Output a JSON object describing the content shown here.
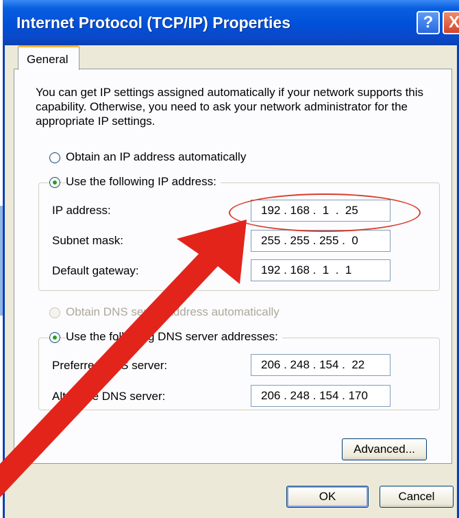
{
  "window": {
    "title": "Internet Protocol (TCP/IP) Properties",
    "help_label": "?",
    "close_label": "X"
  },
  "tab": {
    "label": "General"
  },
  "description": "You can get IP settings assigned automatically if your network supports this capability. Otherwise, you need to ask your network administrator for the appropriate IP settings.",
  "ip_section": {
    "auto_label": "Obtain an IP address automatically",
    "manual_label": "Use the following IP address:",
    "ip_label": "IP address:",
    "ip_value": "192 . 168 .  1  .  25",
    "subnet_label": "Subnet mask:",
    "subnet_value": "255 . 255 . 255 .  0",
    "gateway_label": "Default gateway:",
    "gateway_value": "192 . 168 .  1  .  1",
    "selected": "manual"
  },
  "dns_section": {
    "auto_label": "Obtain DNS server address automatically",
    "manual_label": "Use the following DNS server addresses:",
    "preferred_label": "Preferred DNS server:",
    "preferred_value": "206 . 248 . 154 .  22",
    "alternate_label": "Alternate DNS server:",
    "alternate_value": "206 . 248 . 154 . 170",
    "selected": "manual"
  },
  "buttons": {
    "advanced": "Advanced...",
    "ok": "OK",
    "cancel": "Cancel"
  },
  "colors": {
    "titlebar": "#0050d8",
    "annotation_red": "#e3241b",
    "deco_blue": "#8fb4e8"
  }
}
